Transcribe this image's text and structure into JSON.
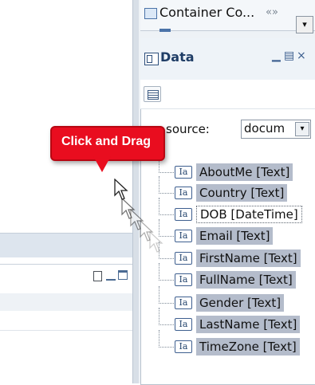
{
  "container_tab": {
    "label": "Container Co...",
    "close_glyph": "«»",
    "dropdown_glyph": "▾"
  },
  "data_panel": {
    "title": "Data",
    "minimize_glyph": "▁",
    "maximize_glyph": "▤",
    "close_glyph": "×",
    "source_label": "Data source:",
    "source_visible_label": "source:",
    "source_value": "docum",
    "source_arrow": "▾",
    "fields": [
      {
        "icon_text": "Ia",
        "label": "AboutMe [Text]",
        "selected": true
      },
      {
        "icon_text": "Ia",
        "label": "Country [Text]",
        "selected": true
      },
      {
        "icon_text": "Ia",
        "label": "DOB [DateTime]",
        "selected": false
      },
      {
        "icon_text": "Ia",
        "label": "Email [Text]",
        "selected": true
      },
      {
        "icon_text": "Ia",
        "label": "FirstName [Text]",
        "selected": true
      },
      {
        "icon_text": "Ia",
        "label": "FullName [Text]",
        "selected": true
      },
      {
        "icon_text": "Ia",
        "label": "Gender [Text]",
        "selected": true
      },
      {
        "icon_text": "Ia",
        "label": "LastName [Text]",
        "selected": true
      },
      {
        "icon_text": "Ia",
        "label": "TimeZone [Text]",
        "selected": true
      }
    ]
  },
  "callout": {
    "text": "Click and Drag",
    "color": "#e90d1f"
  },
  "icons": {
    "container_tab": "container-icon",
    "data_panel": "data-panel-icon",
    "field": "text-field-icon",
    "toolbar": "list-view-icon",
    "cursor": "arrow-cursor-icon"
  },
  "colors": {
    "selection": "#b4bccb",
    "panel_header": "#eef3f8",
    "accent": "#1f3d66"
  }
}
